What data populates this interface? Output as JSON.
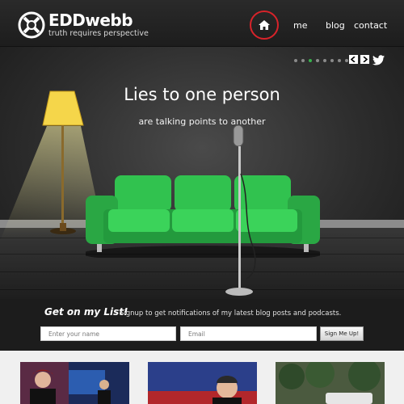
{
  "header": {
    "logo_title": "EDDwebb",
    "logo_tagline": "truth requires perspective",
    "nav": {
      "home_icon": "home-icon",
      "me": "me",
      "blog": "blog",
      "contact": "contact"
    },
    "highlight_color": "#d8232a"
  },
  "hero": {
    "title": "Lies to one person",
    "subtitle": "are talking points to another",
    "slide_count": 8,
    "active_slide": 3,
    "icons": [
      "arrow-left-icon",
      "arrow-right-icon",
      "twitter-icon"
    ],
    "couch_color": "#2bb34a"
  },
  "signup": {
    "title": "Get on my List!",
    "text": "Signup to get notifications of my latest blog posts and podcasts.",
    "name_placeholder": "Enter your name",
    "email_placeholder": "Email",
    "button": "Sign Me Up!"
  },
  "thumbnails": [
    {
      "icon": "news-anchor-thumbnail"
    },
    {
      "icon": "politician-thumbnail"
    },
    {
      "icon": "outdoor-thumbnail"
    }
  ]
}
